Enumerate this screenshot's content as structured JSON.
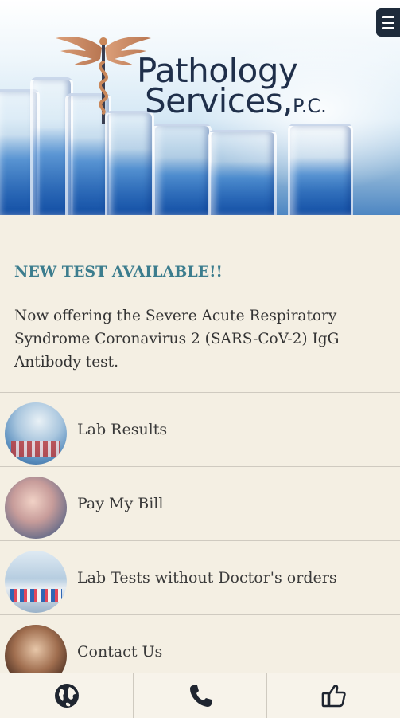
{
  "header": {
    "brand_line1": "Pathology",
    "brand_line2": "Services,",
    "brand_suffix": "P.C.",
    "menu_icon": "hamburger-menu-icon"
  },
  "announcement": {
    "title": "NEW TEST AVAILABLE!!",
    "body": "Now offering the Severe Acute Respiratory Syndrome Coronavirus 2 (SARS-CoV-2) IgG Antibody test."
  },
  "menu": [
    {
      "label": "Lab Results",
      "icon": "lab-results-photo"
    },
    {
      "label": "Pay My Bill",
      "icon": "pay-bill-photo"
    },
    {
      "label": "Lab Tests without Doctor's orders",
      "icon": "lab-tests-photo"
    },
    {
      "label": "Contact Us",
      "icon": "contact-photo"
    }
  ],
  "bottom_nav": [
    {
      "icon": "globe-icon"
    },
    {
      "icon": "phone-icon"
    },
    {
      "icon": "thumbs-up-icon"
    }
  ],
  "colors": {
    "background": "#f4efe3",
    "announcement_title": "#3c7d8e",
    "brand_text": "#1f2f4a",
    "menu_button": "#1e2b3b"
  }
}
